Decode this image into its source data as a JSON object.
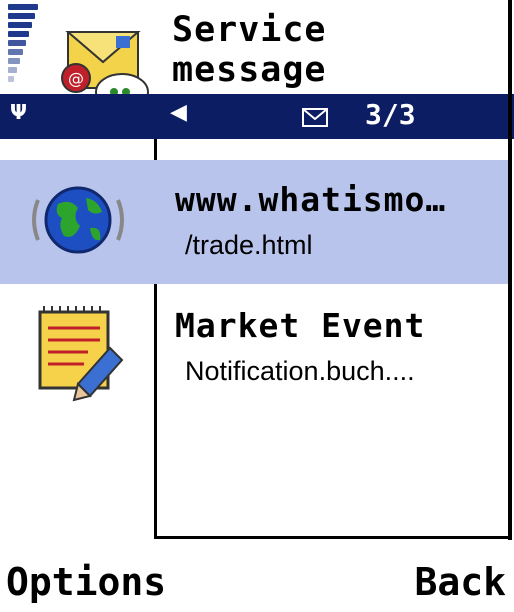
{
  "header": {
    "title_line1": "Service",
    "title_line2": "message",
    "app_icon": "service-message-icon"
  },
  "navbar": {
    "antenna_icon": "antenna-icon",
    "left_arrow": "◀",
    "envelope_icon": "envelope-icon",
    "counter": "3/3",
    "bg_color": "#0d1d63"
  },
  "messages": [
    {
      "icon": "globe-icon",
      "title": "www.whatismo…",
      "subtitle": "/trade.html",
      "selected": true
    },
    {
      "icon": "notepad-icon",
      "title": "Market Event",
      "subtitle": "Notification.buch....",
      "selected": false
    }
  ],
  "softkeys": {
    "left": "Options",
    "right": "Back"
  },
  "colors": {
    "selection": "#b8c4eb",
    "signal": "#1f3a8c"
  }
}
